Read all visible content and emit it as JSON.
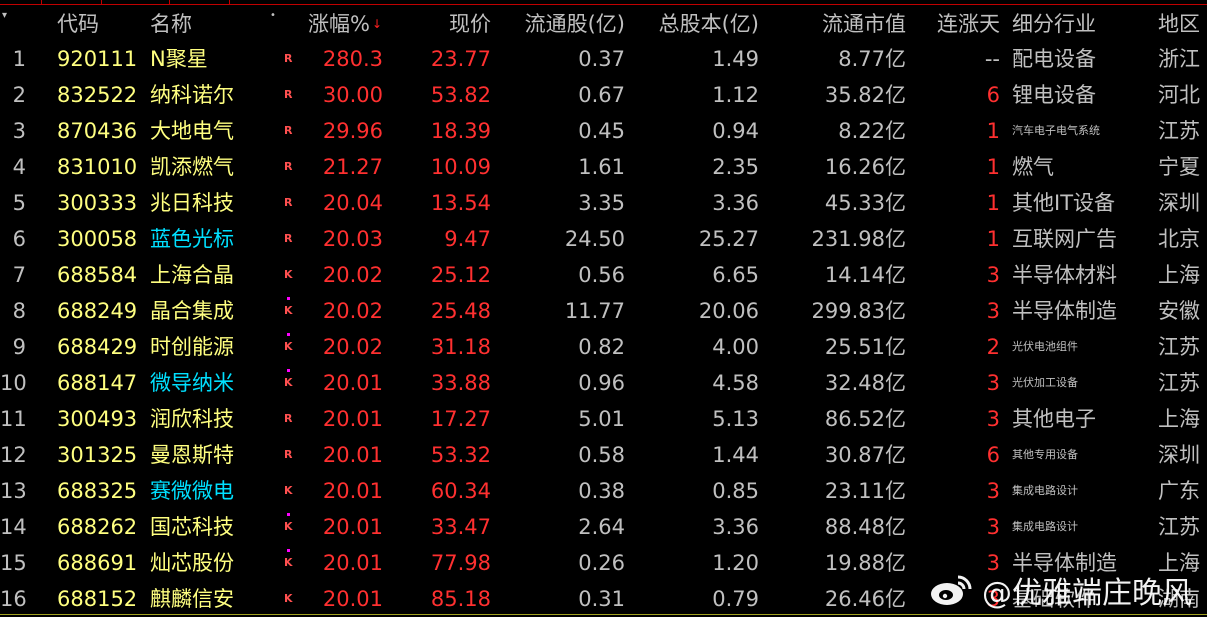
{
  "header": {
    "index_marker": "▾",
    "code": "代码",
    "name": "名称",
    "marker_dot": "•",
    "change": "涨幅%",
    "sort_icon": "arrow-down",
    "price": "现价",
    "float_shares": "流通股(亿)",
    "total_shares": "总股本(亿)",
    "float_cap": "流通市值",
    "streak": "连涨天",
    "industry": "细分行业",
    "region": "地区"
  },
  "colors": {
    "up": "#ff3030",
    "code": "#ffff80",
    "name_default": "#ffff80",
    "name_highlight": "#00e0ff",
    "text": "#c0c0c0",
    "dot": "#ff00ff"
  },
  "rows": [
    {
      "idx": "1",
      "code": "920111",
      "name": "N聚星",
      "hl": false,
      "mk": "R",
      "dot": false,
      "chg": "280.3",
      "price": "23.77",
      "flt": "0.37",
      "tot": "1.49",
      "cap": "8.77亿",
      "days": "--",
      "ind": "配电设备",
      "small": false,
      "reg": "浙江"
    },
    {
      "idx": "2",
      "code": "832522",
      "name": "纳科诺尔",
      "hl": false,
      "mk": "R",
      "dot": false,
      "chg": "30.00",
      "price": "53.82",
      "flt": "0.67",
      "tot": "1.12",
      "cap": "35.82亿",
      "days": "6",
      "ind": "锂电设备",
      "small": false,
      "reg": "河北"
    },
    {
      "idx": "3",
      "code": "870436",
      "name": "大地电气",
      "hl": false,
      "mk": "R",
      "dot": false,
      "chg": "29.96",
      "price": "18.39",
      "flt": "0.45",
      "tot": "0.94",
      "cap": "8.22亿",
      "days": "1",
      "ind": "汽车电子电气系统",
      "small": true,
      "reg": "江苏"
    },
    {
      "idx": "4",
      "code": "831010",
      "name": "凯添燃气",
      "hl": false,
      "mk": "R",
      "dot": false,
      "chg": "21.27",
      "price": "10.09",
      "flt": "1.61",
      "tot": "2.35",
      "cap": "16.26亿",
      "days": "1",
      "ind": "燃气",
      "small": false,
      "reg": "宁夏"
    },
    {
      "idx": "5",
      "code": "300333",
      "name": "兆日科技",
      "hl": false,
      "mk": "R",
      "dot": false,
      "chg": "20.04",
      "price": "13.54",
      "flt": "3.35",
      "tot": "3.36",
      "cap": "45.33亿",
      "days": "1",
      "ind": "其他IT设备",
      "small": false,
      "reg": "深圳"
    },
    {
      "idx": "6",
      "code": "300058",
      "name": "蓝色光标",
      "hl": true,
      "mk": "R",
      "dot": false,
      "chg": "20.03",
      "price": "9.47",
      "flt": "24.50",
      "tot": "25.27",
      "cap": "231.98亿",
      "days": "1",
      "ind": "互联网广告",
      "small": false,
      "reg": "北京"
    },
    {
      "idx": "7",
      "code": "688584",
      "name": "上海合晶",
      "hl": false,
      "mk": "K",
      "dot": false,
      "chg": "20.02",
      "price": "25.12",
      "flt": "0.56",
      "tot": "6.65",
      "cap": "14.14亿",
      "days": "3",
      "ind": "半导体材料",
      "small": false,
      "reg": "上海"
    },
    {
      "idx": "8",
      "code": "688249",
      "name": "晶合集成",
      "hl": false,
      "mk": "K",
      "dot": true,
      "chg": "20.02",
      "price": "25.48",
      "flt": "11.77",
      "tot": "20.06",
      "cap": "299.83亿",
      "days": "3",
      "ind": "半导体制造",
      "small": false,
      "reg": "安徽"
    },
    {
      "idx": "9",
      "code": "688429",
      "name": "时创能源",
      "hl": false,
      "mk": "K",
      "dot": true,
      "chg": "20.02",
      "price": "31.18",
      "flt": "0.82",
      "tot": "4.00",
      "cap": "25.51亿",
      "days": "2",
      "ind": "光伏电池组件",
      "small": true,
      "reg": "江苏"
    },
    {
      "idx": "10",
      "code": "688147",
      "name": "微导纳米",
      "hl": true,
      "mk": "K",
      "dot": true,
      "chg": "20.01",
      "price": "33.88",
      "flt": "0.96",
      "tot": "4.58",
      "cap": "32.48亿",
      "days": "3",
      "ind": "光伏加工设备",
      "small": true,
      "reg": "江苏"
    },
    {
      "idx": "11",
      "code": "300493",
      "name": "润欣科技",
      "hl": false,
      "mk": "R",
      "dot": false,
      "chg": "20.01",
      "price": "17.27",
      "flt": "5.01",
      "tot": "5.13",
      "cap": "86.52亿",
      "days": "3",
      "ind": "其他电子",
      "small": false,
      "reg": "上海"
    },
    {
      "idx": "12",
      "code": "301325",
      "name": "曼恩斯特",
      "hl": false,
      "mk": "R",
      "dot": false,
      "chg": "20.01",
      "price": "53.32",
      "flt": "0.58",
      "tot": "1.44",
      "cap": "30.87亿",
      "days": "6",
      "ind": "其他专用设备",
      "small": true,
      "reg": "深圳"
    },
    {
      "idx": "13",
      "code": "688325",
      "name": "赛微微电",
      "hl": true,
      "mk": "K",
      "dot": false,
      "chg": "20.01",
      "price": "60.34",
      "flt": "0.38",
      "tot": "0.85",
      "cap": "23.11亿",
      "days": "3",
      "ind": "集成电路设计",
      "small": true,
      "reg": "广东"
    },
    {
      "idx": "14",
      "code": "688262",
      "name": "国芯科技",
      "hl": false,
      "mk": "K",
      "dot": true,
      "chg": "20.01",
      "price": "33.47",
      "flt": "2.64",
      "tot": "3.36",
      "cap": "88.48亿",
      "days": "3",
      "ind": "集成电路设计",
      "small": true,
      "reg": "江苏"
    },
    {
      "idx": "15",
      "code": "688691",
      "name": "灿芯股份",
      "hl": false,
      "mk": "K",
      "dot": true,
      "chg": "20.01",
      "price": "77.98",
      "flt": "0.26",
      "tot": "1.20",
      "cap": "19.88亿",
      "days": "3",
      "ind": "半导体制造",
      "small": false,
      "reg": "上海"
    },
    {
      "idx": "16",
      "code": "688152",
      "name": "麒麟信安",
      "hl": false,
      "mk": "K",
      "dot": false,
      "chg": "20.01",
      "price": "85.18",
      "flt": "0.31",
      "tot": "0.79",
      "cap": "26.46亿",
      "days": "3",
      "ind": "基础软件",
      "small": false,
      "reg": "湖南"
    }
  ],
  "watermark": {
    "text": "@优雅端庄晚风",
    "icon": "weibo-icon"
  }
}
